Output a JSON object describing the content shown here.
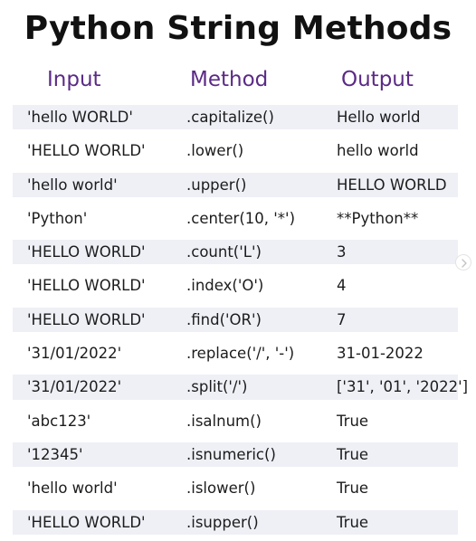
{
  "title": "Python String Methods",
  "headers": {
    "input": "Input",
    "method": "Method",
    "output": "Output"
  },
  "rows": [
    {
      "input": "'hello WORLD'",
      "method": ".capitalize()",
      "output": "Hello world"
    },
    {
      "input": "'HELLO WORLD'",
      "method": ".lower()",
      "output": "hello world"
    },
    {
      "input": "'hello world'",
      "method": ".upper()",
      "output": "HELLO WORLD"
    },
    {
      "input": "'Python'",
      "method": ".center(10, '*')",
      "output": "**Python**"
    },
    {
      "input": "'HELLO WORLD'",
      "method": ".count('L')",
      "output": "3"
    },
    {
      "input": "'HELLO WORLD'",
      "method": ".index('O')",
      "output": "4"
    },
    {
      "input": "'HELLO WORLD'",
      "method": ".find('OR')",
      "output": "7"
    },
    {
      "input": "'31/01/2022'",
      "method": ".replace('/', '-')",
      "output": "31-01-2022"
    },
    {
      "input": "'31/01/2022'",
      "method": ".split('/')",
      "output": "['31', '01', '2022']"
    },
    {
      "input": "'abc123'",
      "method": ".isalnum()",
      "output": "True"
    },
    {
      "input": "'12345'",
      "method": ".isnumeric()",
      "output": "True"
    },
    {
      "input": "'hello world'",
      "method": ".islower()",
      "output": "True"
    },
    {
      "input": "'HELLO WORLD'",
      "method": ".isupper()",
      "output": "True"
    }
  ],
  "colors": {
    "header": "#5b2a86",
    "row_shade": "#eef0f6",
    "text": "#1c1c1c"
  },
  "icons": {
    "scroll": "chevron-right-icon"
  }
}
